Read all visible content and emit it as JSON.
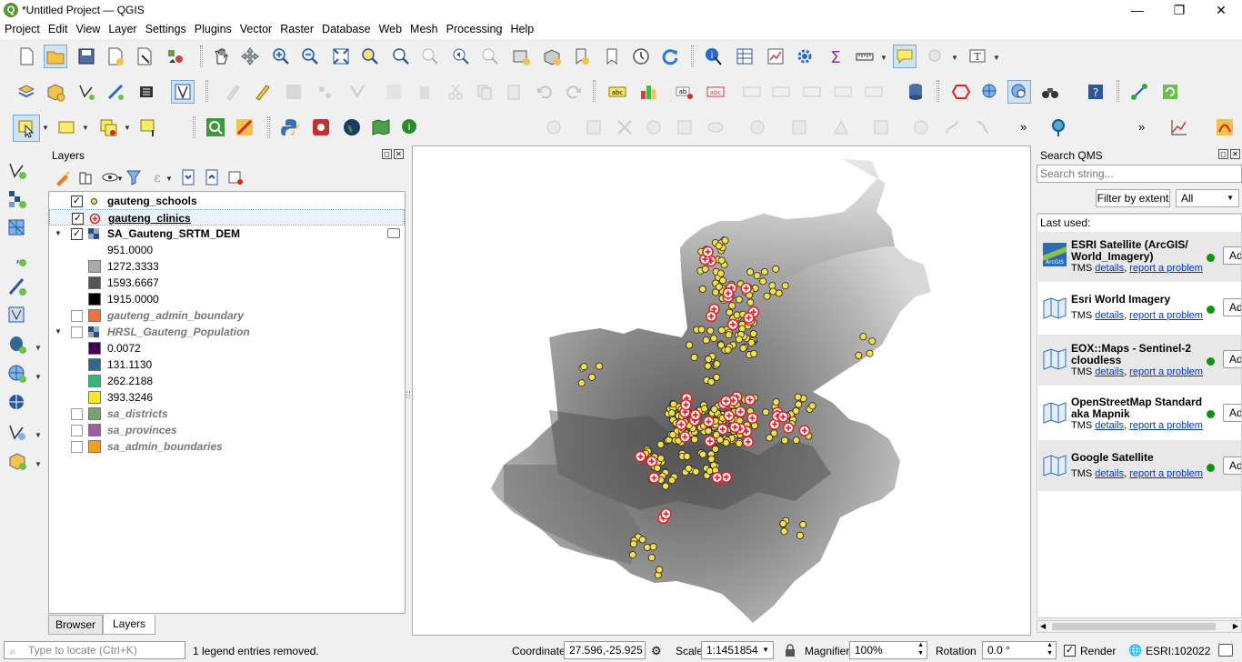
{
  "window": {
    "title": "*Untitled Project — QGIS",
    "app_icon": "Q"
  },
  "menu": [
    "Project",
    "Edit",
    "View",
    "Layer",
    "Settings",
    "Plugins",
    "Vector",
    "Raster",
    "Database",
    "Web",
    "Mesh",
    "Processing",
    "Help"
  ],
  "layers_panel": {
    "title": "Layers",
    "layers": [
      {
        "name": "gauteng_schools",
        "checked": true,
        "symbol": "yellow-point-icon"
      },
      {
        "name": "gauteng_clinics",
        "checked": true,
        "symbol": "red-cross-point-icon"
      },
      {
        "name": "SA_Gauteng_SRTM_DEM",
        "checked": true,
        "symbol": "raster-icon",
        "legend": [
          {
            "label": "951.0000",
            "color": "#ffffff"
          },
          {
            "label": "1272.3333",
            "color": "#aaaaaa"
          },
          {
            "label": "1593.6667",
            "color": "#555555"
          },
          {
            "label": "1915.0000",
            "color": "#000000"
          }
        ]
      },
      {
        "name": "gauteng_admin_boundary",
        "checked": false,
        "color": "#e8743b"
      },
      {
        "name": "HRSL_Gauteng_Population",
        "checked": false,
        "symbol": "raster-icon",
        "legend": [
          {
            "label": "0.0072",
            "color": "#440154"
          },
          {
            "label": "131.1130",
            "color": "#31688e"
          },
          {
            "label": "262.2188",
            "color": "#35b779"
          },
          {
            "label": "393.3246",
            "color": "#fde725"
          }
        ]
      },
      {
        "name": "sa_districts",
        "checked": false,
        "color": "#74a66b"
      },
      {
        "name": "sa_provinces",
        "checked": false,
        "color": "#9b5fa0"
      },
      {
        "name": "sa_admin_boundaries",
        "checked": false,
        "color": "#f39c1e"
      }
    ],
    "tabs": [
      "Browser",
      "Layers"
    ],
    "active_tab": "Layers"
  },
  "qms_panel": {
    "title": "Search QMS",
    "search_placeholder": "Search string...",
    "filter_button": "Filter by extent",
    "filter_select": "All",
    "last_used_label": "Last used:",
    "items": [
      {
        "name": "ESRI Satellite (ArcGIS/ World_Imagery)",
        "type": "TMS",
        "details": "details",
        "report": "report a problem",
        "add": "Add"
      },
      {
        "name": "Esri World Imagery",
        "type": "TMS",
        "details": "details",
        "report": "report a problem",
        "add": "Add"
      },
      {
        "name": "EOX::Maps - Sentinel-2 cloudless",
        "type": "TMS",
        "details": "details",
        "report": "report a problem",
        "add": "Add"
      },
      {
        "name": "OpenStreetMap Standard aka Mapnik",
        "type": "TMS",
        "details": "details",
        "report": "report a problem",
        "add": "Add"
      },
      {
        "name": "Google Satellite",
        "type": "TMS",
        "details": "details",
        "report": "report a problem",
        "add": "Add"
      }
    ]
  },
  "statusbar": {
    "locate_placeholder": "Type to locate (Ctrl+K)",
    "message": "1 legend entries removed.",
    "coordinate_label": "Coordinate",
    "coordinate": "27.596,-25.925",
    "scale_label": "Scale",
    "scale": "1:1451854",
    "magnifier_label": "Magnifier",
    "magnifier": "100%",
    "rotation_label": "Rotation",
    "rotation": "0.0 °",
    "render_label": "Render",
    "crs": "ESRI:102022"
  },
  "colors": {
    "school": "#f5e04a",
    "clinic": "#e0252b",
    "qgis_green": "#589632"
  }
}
